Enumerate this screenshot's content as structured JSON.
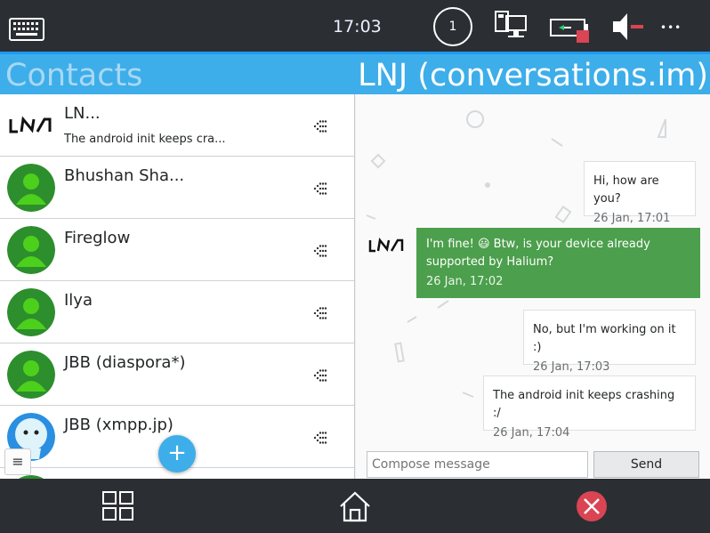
{
  "statusbar": {
    "time": "17:03",
    "notification_count": "1",
    "icons": [
      "keyboard-icon",
      "network-icon",
      "battery-icon",
      "volume-muted-icon",
      "more-icon"
    ]
  },
  "header": {
    "left_title": "Contacts",
    "right_title": "LNJ (conversations.im)"
  },
  "contacts": [
    {
      "name": "LN...",
      "preview": "The android init keeps cra...",
      "avatar": "lnj-logo"
    },
    {
      "name": "Bhushan Sha...",
      "preview": "",
      "avatar": "default-person"
    },
    {
      "name": "Fireglow",
      "preview": "",
      "avatar": "default-person"
    },
    {
      "name": "Ilya",
      "preview": "",
      "avatar": "default-person"
    },
    {
      "name": "JBB (diaspora*)",
      "preview": "",
      "avatar": "default-person"
    },
    {
      "name": "JBB (xmpp.jp)",
      "preview": "",
      "avatar": "ghost"
    }
  ],
  "messages": [
    {
      "text": "Hi, how are you?",
      "time": "26 Jan, 17:01",
      "direction": "out"
    },
    {
      "text": "I'm fine! 😃  Btw, is your device already supported by Halium?",
      "time": "26 Jan, 17:02",
      "direction": "in"
    },
    {
      "text": "No, but I'm working on it :)",
      "time": "26 Jan, 17:03",
      "direction": "out"
    },
    {
      "text": "The android init keeps crashing :/",
      "time": "26 Jan, 17:04",
      "direction": "out"
    }
  ],
  "compose": {
    "placeholder": "Compose message",
    "send_label": "Send"
  },
  "fab_label": "+",
  "menu_label": "≡",
  "more_label": "•••",
  "colors": {
    "accent": "#3daee9",
    "topbar": "#2b2f33",
    "incoming_bubble": "#4c9f4c",
    "close_button": "#da4453"
  }
}
